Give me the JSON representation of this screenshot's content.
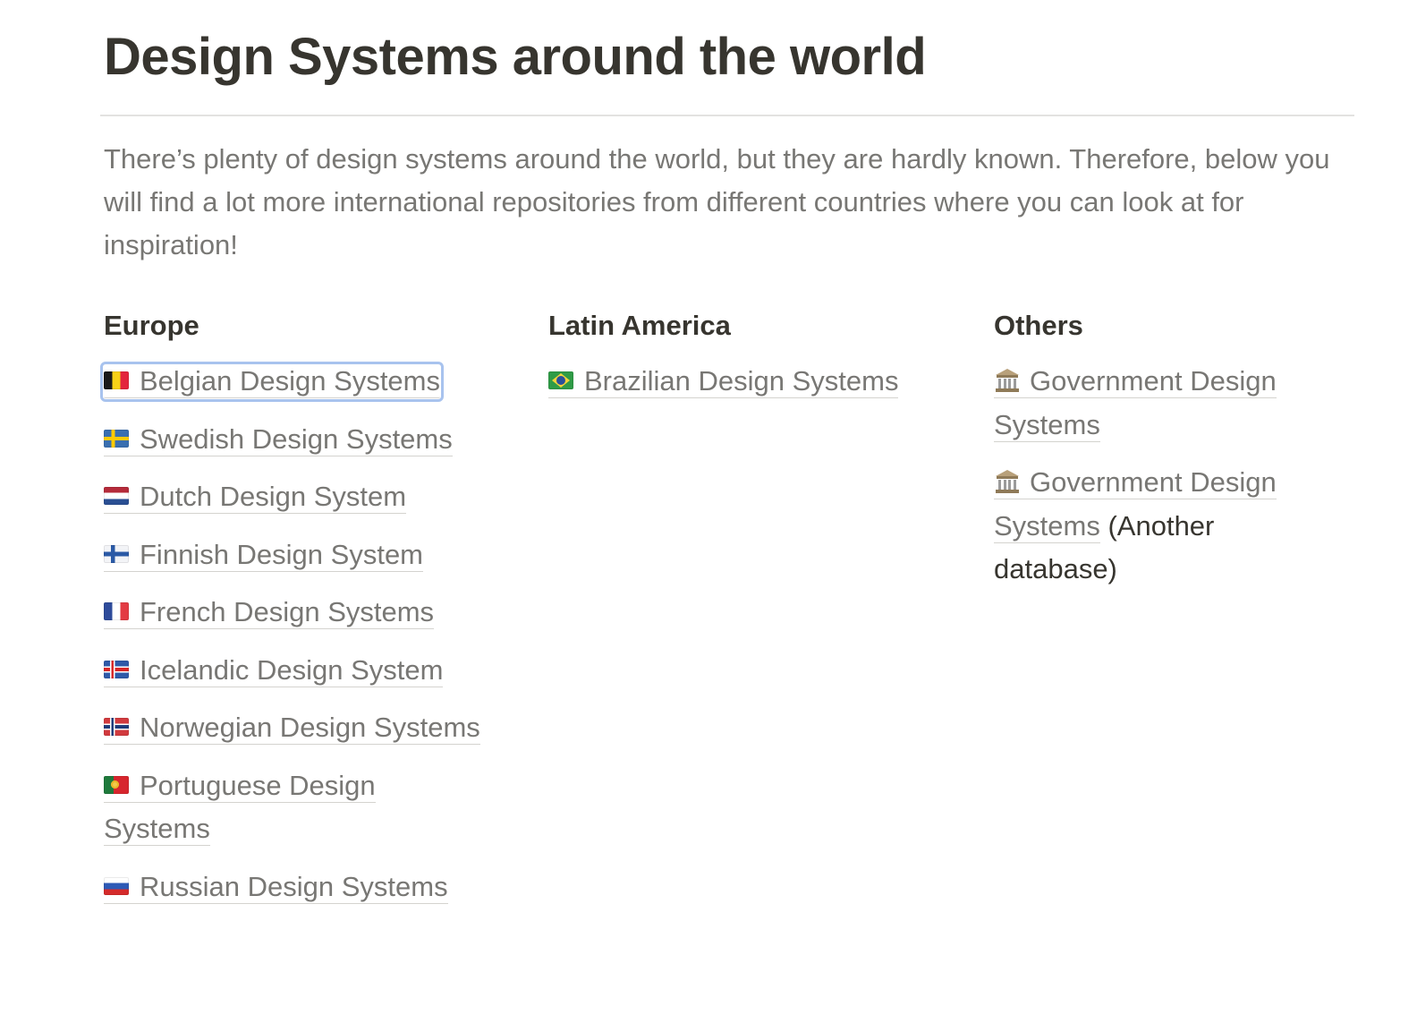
{
  "page": {
    "title": "Design Systems around the world",
    "intro": "There’s plenty of design systems around the world, but they are hardly known. Therefore, below you will find a lot more international repositories from different countries where you can look at for inspiration!"
  },
  "columns": {
    "europe": {
      "heading": "Europe",
      "links": [
        {
          "label": "Belgian Design Systems",
          "icon": "flag-belgium"
        },
        {
          "label": "Swedish Design Systems",
          "icon": "flag-sweden"
        },
        {
          "label": "Dutch Design System",
          "icon": "flag-netherlands"
        },
        {
          "label": "Finnish Design System",
          "icon": "flag-finland"
        },
        {
          "label": "French Design Systems",
          "icon": "flag-france"
        },
        {
          "label": "Icelandic Design System",
          "icon": "flag-iceland"
        },
        {
          "label": "Norwegian Design Systems",
          "icon": "flag-norway"
        },
        {
          "label": "Portuguese Design Systems",
          "icon": "flag-portugal"
        },
        {
          "label": "Russian Design Systems",
          "icon": "flag-russia"
        }
      ]
    },
    "latin_america": {
      "heading": "Latin America",
      "links": [
        {
          "label": "Brazilian Design Systems",
          "icon": "flag-brazil"
        }
      ]
    },
    "others": {
      "heading": "Others",
      "links": [
        {
          "label": "Government Design Systems",
          "icon": "classical-building-icon"
        },
        {
          "label": "Government Design Systems",
          "suffix": " (Another database)",
          "icon": "classical-building-icon"
        }
      ]
    }
  },
  "colors": {
    "text": "#37352f",
    "muted_link": "#787774",
    "divider": "#e3e2e0",
    "focus_ring": "#a8c3ee"
  }
}
